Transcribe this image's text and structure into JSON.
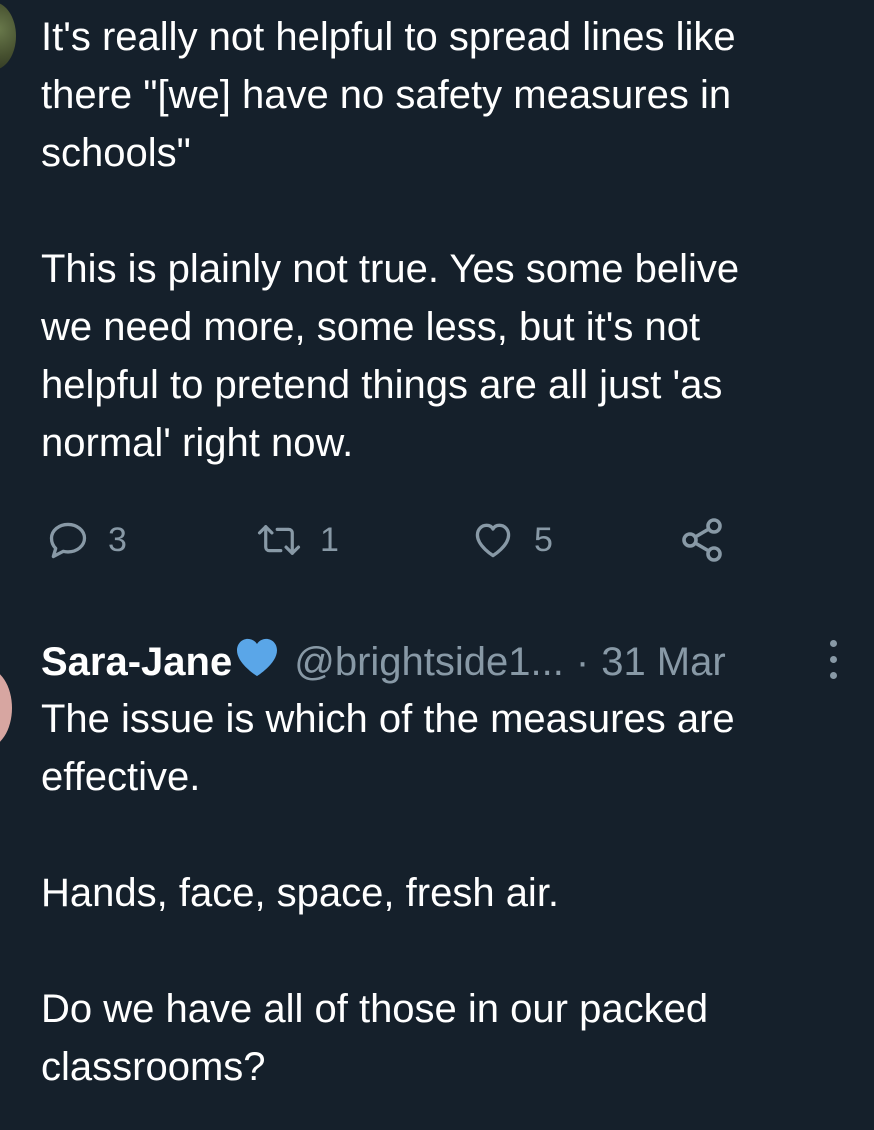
{
  "tweet1": {
    "text": "It's really not helpful to spread lines like\nthere \"[we] have no safety measures in\nschools\"\n\nThis is plainly not true. Yes some belive\nwe need more, some less, but it's not\nhelpful to pretend things are all just 'as\nnormal' right now.",
    "reply_count": "3",
    "retweet_count": "1",
    "like_count": "5"
  },
  "tweet2": {
    "display_name": "Sara-Jane",
    "badge_icon": "blue-heart-icon",
    "handle": "@brightside1...",
    "separator": "·",
    "timestamp": "31 Mar",
    "text": "The issue is which of the measures are\neffective.\n\nHands, face, space, fresh air.\n\nDo we have all of those in our packed\nclassrooms?"
  },
  "icons": {
    "reply": "reply-icon",
    "retweet": "retweet-icon",
    "like": "heart-icon",
    "share": "share-icon",
    "more": "more-vertical-icon"
  },
  "colors": {
    "background": "#15202b",
    "text": "#ffffff",
    "secondary": "#8899a6",
    "heart_badge": "#5aa6e8"
  }
}
